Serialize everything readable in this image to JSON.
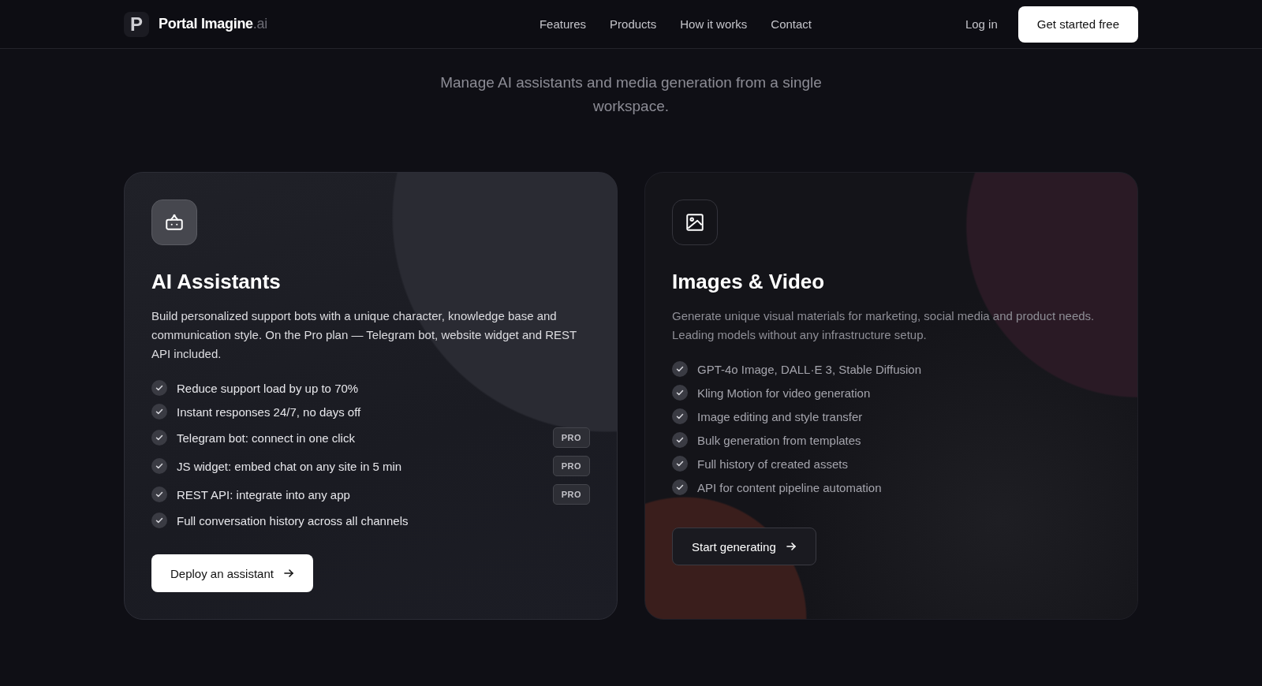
{
  "nav": {
    "logo_letter": "P",
    "brand": "Portal Imagine",
    "brand_suffix": ".ai",
    "links": [
      "Features",
      "Products",
      "How it works",
      "Contact"
    ],
    "login": "Log in",
    "cta": "Get started free"
  },
  "intro": {
    "subtitle": "Manage AI assistants and media generation from a single workspace."
  },
  "cards": [
    {
      "kind": "assistant",
      "highlighted": true,
      "title": "AI Assistants",
      "description": "Build personalized support bots with a unique character, knowledge base and communication style. On the Pro plan — Telegram bot, website widget and REST API included.",
      "features": [
        {
          "text": "Reduce support load by up to 70%"
        },
        {
          "text": "Instant responses 24/7, no days off"
        },
        {
          "text": "Telegram bot: connect in one click",
          "badge": "PRO"
        },
        {
          "text": "JS widget: embed chat on any site in 5 min",
          "badge": "PRO"
        },
        {
          "text": "REST API: integrate into any app",
          "badge": "PRO"
        },
        {
          "text": "Full conversation history across all channels"
        }
      ],
      "button": "Deploy an assistant"
    },
    {
      "kind": "media",
      "highlighted": false,
      "title": "Images & Video",
      "description": "Generate unique visual materials for marketing, social media and product needs. Leading models without any infrastructure setup.",
      "features": [
        {
          "text": "GPT-4o Image, DALL·E 3, Stable Diffusion"
        },
        {
          "text": "Kling Motion for video generation"
        },
        {
          "text": "Image editing and style transfer"
        },
        {
          "text": "Bulk generation from templates"
        },
        {
          "text": "Full history of created assets"
        },
        {
          "text": "API for content pipeline automation"
        }
      ],
      "button": "Start generating"
    }
  ]
}
